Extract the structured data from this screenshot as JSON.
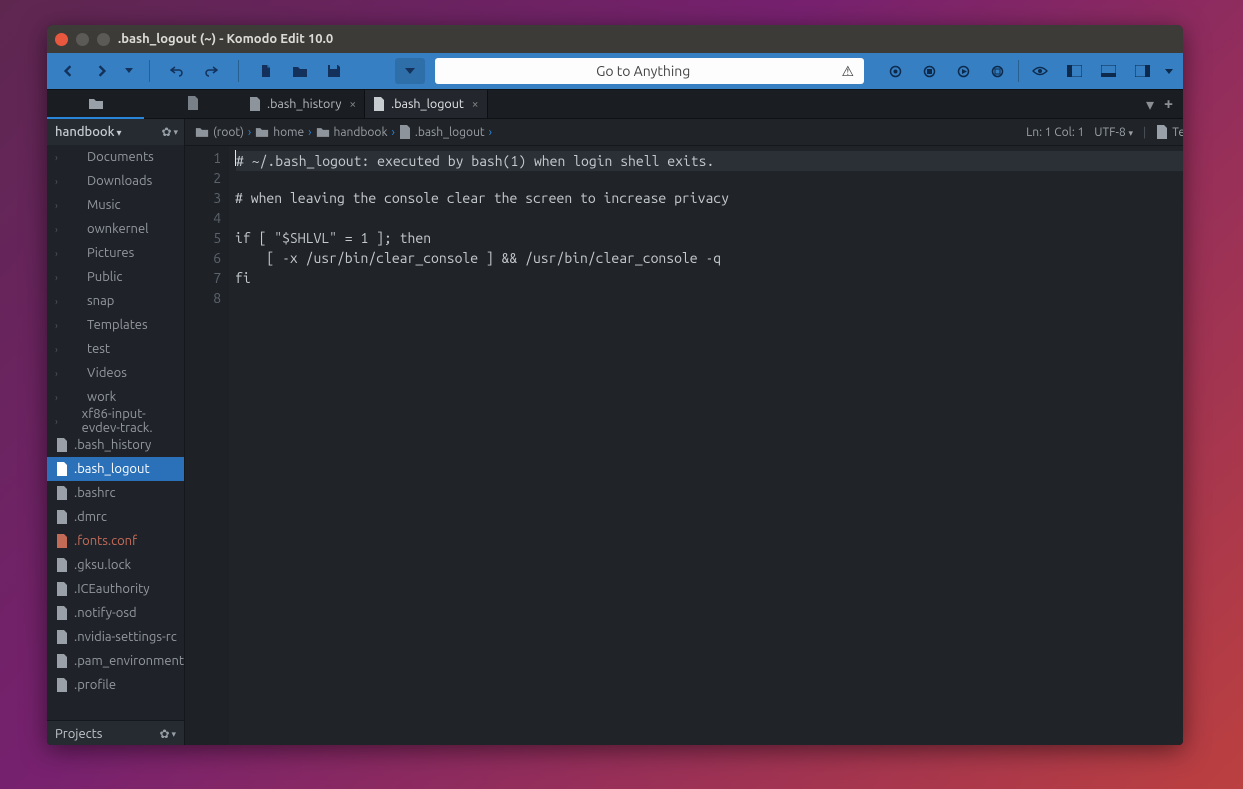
{
  "window": {
    "title": ".bash_logout (~) - Komodo Edit 10.0"
  },
  "search": {
    "placeholder": "Go to Anything"
  },
  "tabs": [
    {
      "label": ".bash_history",
      "active": false
    },
    {
      "label": ".bash_logout",
      "active": true
    }
  ],
  "sidebar": {
    "header": "handbook",
    "footer": "Projects",
    "items": [
      {
        "label": "Documents",
        "type": "folder"
      },
      {
        "label": "Downloads",
        "type": "folder"
      },
      {
        "label": "Music",
        "type": "folder"
      },
      {
        "label": "ownkernel",
        "type": "folder"
      },
      {
        "label": "Pictures",
        "type": "folder"
      },
      {
        "label": "Public",
        "type": "folder"
      },
      {
        "label": "snap",
        "type": "folder"
      },
      {
        "label": "Templates",
        "type": "folder"
      },
      {
        "label": "test",
        "type": "folder"
      },
      {
        "label": "Videos",
        "type": "folder"
      },
      {
        "label": "work",
        "type": "folder"
      },
      {
        "label": "xf86-input-evdev-track.",
        "type": "folder"
      },
      {
        "label": ".bash_history",
        "type": "file"
      },
      {
        "label": ".bash_logout",
        "type": "file",
        "selected": true
      },
      {
        "label": ".bashrc",
        "type": "file"
      },
      {
        "label": ".dmrc",
        "type": "file"
      },
      {
        "label": ".fonts.conf",
        "type": "file",
        "color": "#c46b58"
      },
      {
        "label": ".gksu.lock",
        "type": "file"
      },
      {
        "label": ".ICEauthority",
        "type": "file"
      },
      {
        "label": ".notify-osd",
        "type": "file"
      },
      {
        "label": ".nvidia-settings-rc",
        "type": "file"
      },
      {
        "label": ".pam_environment",
        "type": "file"
      },
      {
        "label": ".profile",
        "type": "file"
      }
    ]
  },
  "breadcrumbs": [
    "(root)",
    "home",
    "handbook",
    ".bash_logout"
  ],
  "status": {
    "pos": "Ln: 1 Col: 1",
    "enc": "UTF-8",
    "lang": "Text"
  },
  "code": {
    "lines": [
      "# ~/.bash_logout: executed by bash(1) when login shell exits.",
      "",
      "# when leaving the console clear the screen to increase privacy",
      "",
      "if [ \"$SHLVL\" = 1 ]; then",
      "    [ -x /usr/bin/clear_console ] && /usr/bin/clear_console -q",
      "fi",
      ""
    ]
  }
}
